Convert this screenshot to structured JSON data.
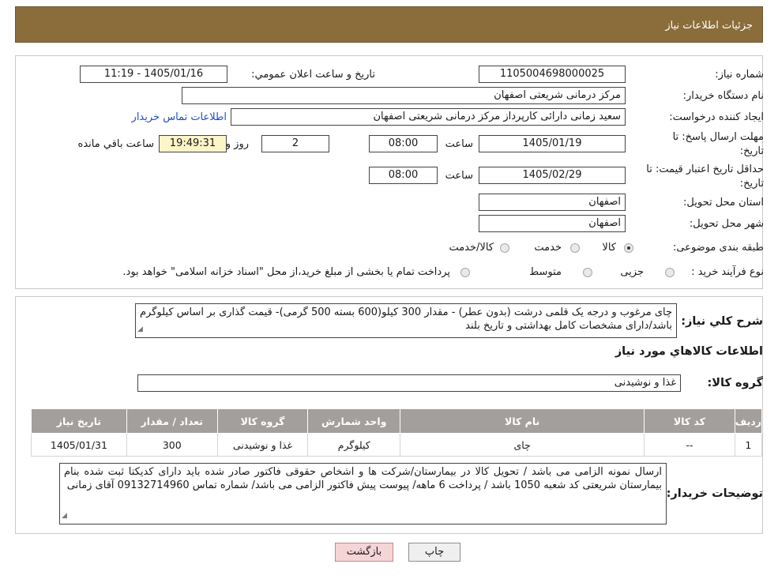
{
  "header": {
    "title": "جزئیات اطلاعات نیاز"
  },
  "form": {
    "need_number_label": "شماره نیاز:",
    "need_number": "1105004698000025",
    "announce_label": "تاريخ و ساعت اعلان عمومي:",
    "announce_value": "1405/01/16 - 11:19",
    "buyer_org_label": "نام دستگاه خريدار:",
    "buyer_org": "مرکز درمانی شریعتی اصفهان",
    "creator_label": "ايجاد کننده درخواست:",
    "creator": "سعید زمانی دارائی کارپرداز مرکز درمانی شریعتی اصفهان",
    "contact_link": "اطلاعات تماس خريدار",
    "deadline_label_1": "مهلت ارسال پاسخ: تا",
    "deadline_label_2": "تاريخ:",
    "deadline_date": "1405/01/19",
    "time_label": "ساعت",
    "deadline_time": "08:00",
    "days_value": "2",
    "days_label": "روز و",
    "remaining_time": "19:49:31",
    "remaining_label": "ساعت باقي مانده",
    "validity_label_1": "حداقل تاريخ اعتبار قيمت: تا",
    "validity_label_2": "تاريخ:",
    "validity_date": "1405/02/29",
    "validity_time": "08:00",
    "province_label": "استان محل تحويل:",
    "province": "اصفهان",
    "city_label": "شهر محل تحويل:",
    "city": "اصفهان",
    "category_label": "طبقه بندی موضوعی:",
    "category_options": [
      "کالا",
      "خدمت",
      "کالا/خدمت"
    ],
    "category_selected": "کالا",
    "process_label": "نوع فرآيند خريد :",
    "process_options": [
      "جزیی",
      "متوسط"
    ],
    "process_note": "پرداخت تمام یا بخشی از مبلغ خرید،از محل \"اسناد خزانه اسلامی\" خواهد بود."
  },
  "description": {
    "label": "شرح کلي نياز:",
    "text": "چای مرغوب و درجه یک قلمی درشت (بدون عطر) - مقدار 300 کیلو(600 بسته 500 گرمی)- قیمت گذاری بر اساس کیلوگرم باشد/دارای مشخصات کامل بهداشتی و تاریخ بلند"
  },
  "goods": {
    "section_title": "اطلاعات کالاهاي مورد نياز",
    "group_label": "گروه کالا:",
    "group_value": "غذا و نوشیدنی",
    "columns": [
      "رديف",
      "کد کالا",
      "نام کالا",
      "واحد شمارش",
      "گروه کالا",
      "تعداد / مقدار",
      "تاريخ نياز"
    ],
    "rows": [
      [
        "1",
        "--",
        "چای",
        "کیلوگرم",
        "غذا و نوشیدنی",
        "300",
        "1405/01/31"
      ]
    ]
  },
  "buyer_notes": {
    "label": "توضيحات خريدار:",
    "text": "ارسال نمونه الزامی می باشد / تحویل کالا در بیمارستان/شرکت ها و اشخاص حقوقی فاکتور صادر شده باید دارای کدیکتا ثبت شده بنام بیمارستان شریعتی کد شعبه 1050 باشد / پرداخت 6 ماهه/ پیوست پیش فاکتور الزامی می باشد/ شماره تماس 09132714960 آقای زمانی"
  },
  "buttons": {
    "print": "چاپ",
    "back": "بازگشت"
  },
  "watermark": {
    "text": "AriaTender.neT"
  },
  "colors": {
    "header_bg": "#8a6d3b",
    "table_header_bg": "#a29f9c",
    "remaining_bg": "#fdf5c8",
    "back_button_bg": "#f5d5d5",
    "link": "#1f4fc4"
  }
}
